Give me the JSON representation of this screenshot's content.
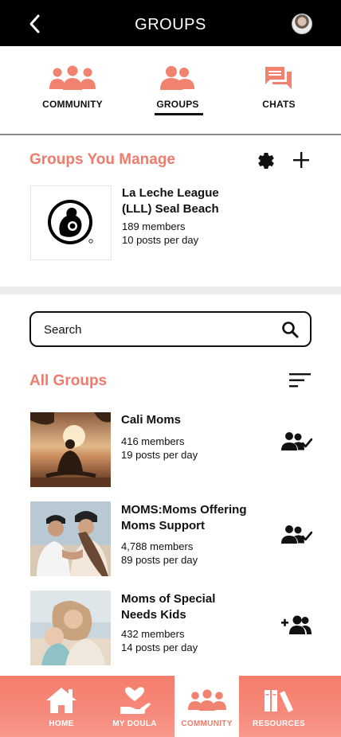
{
  "colors": {
    "accent": "#ee7b6c",
    "header_bg": "#000000",
    "nav_gradient_top": "#f47d6b",
    "nav_gradient_bottom": "#f89a8c"
  },
  "header": {
    "title": "GROUPS",
    "back_icon": "chevron-left-icon",
    "avatar": "user-avatar"
  },
  "tabs": [
    {
      "label": "COMMUNITY",
      "icon": "community-icon",
      "active": false
    },
    {
      "label": "GROUPS",
      "icon": "groups-icon",
      "active": true
    },
    {
      "label": "CHATS",
      "icon": "chats-icon",
      "active": false
    }
  ],
  "manage": {
    "title": "Groups You Manage",
    "settings_icon": "gear-icon",
    "add_icon": "plus-icon",
    "group": {
      "name_line1": "La Leche League",
      "name_line2": "(LLL) Seal Beach",
      "members": "189 members",
      "posts": "10 posts per day"
    }
  },
  "search": {
    "placeholder": "Search"
  },
  "all_groups": {
    "title": "All Groups",
    "sort_icon": "sort-icon",
    "items": [
      {
        "name_line1": "Cali Moms",
        "name_line2": "",
        "members": "416 members",
        "posts": "19 posts per day",
        "action_icon": "group-joined-icon"
      },
      {
        "name_line1": "MOMS:Moms Offering",
        "name_line2": "Moms Support",
        "members": "4,788 members",
        "posts": "89 posts per day",
        "action_icon": "group-joined-icon"
      },
      {
        "name_line1": "Moms of Special",
        "name_line2": "Needs Kids",
        "members": "432 members",
        "posts": "14 posts per day",
        "action_icon": "group-add-icon"
      }
    ]
  },
  "bottom_nav": [
    {
      "label": "HOME",
      "icon": "home-icon",
      "active": false
    },
    {
      "label": "MY DOULA",
      "icon": "doula-icon",
      "active": false
    },
    {
      "label": "COMMUNITY",
      "icon": "community-icon",
      "active": true
    },
    {
      "label": "RESOURCES",
      "icon": "resources-icon",
      "active": false
    }
  ]
}
